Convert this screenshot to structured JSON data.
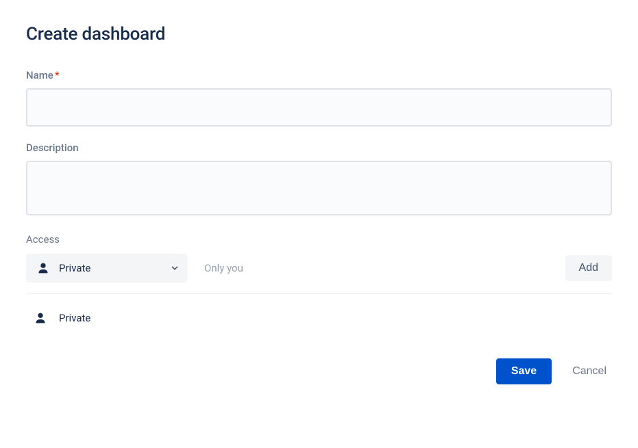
{
  "title": "Create dashboard",
  "fields": {
    "name": {
      "label": "Name",
      "required_mark": "*",
      "value": ""
    },
    "description": {
      "label": "Description",
      "value": ""
    }
  },
  "access": {
    "label": "Access",
    "select": {
      "selected": "Private"
    },
    "hint": "Only you",
    "add_button": "Add",
    "entries": [
      {
        "label": "Private"
      }
    ]
  },
  "footer": {
    "save": "Save",
    "cancel": "Cancel"
  }
}
